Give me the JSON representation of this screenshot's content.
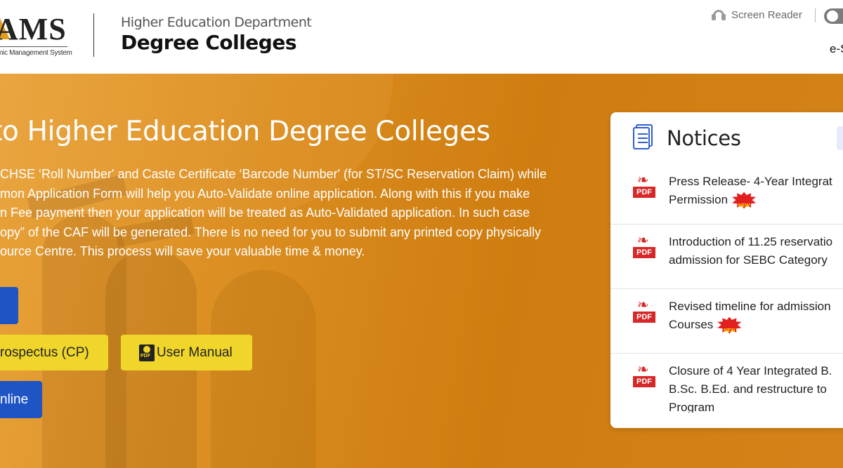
{
  "header": {
    "logo_text": "AMS",
    "logo_subtitle": "mic Management System",
    "department": "Higher Education Department",
    "title": "Degree Colleges",
    "screen_reader_label": "Screen Reader",
    "e_link": "e-S"
  },
  "hero": {
    "title": "to Higher Education Degree Colleges",
    "paragraph": [
      "CHSE ‘Roll Number' and Caste Certificate ‘Barcode Number' (for ST/SC Reservation Claim) while",
      "mon Application Form will help you Auto-Validate online application. Along with this if you make",
      "n Fee payment then your application will be treated as Auto-Validated application. In such case",
      "opy” of the CAF will be generated. There is no need for you to submit any printed copy physically",
      "ource Centre. This process will save your valuable time & money."
    ],
    "buttons": {
      "prospectus": "rospectus (CP)",
      "user_manual": "User Manual",
      "online": "nline"
    }
  },
  "notices": {
    "title": "Notices",
    "items": [
      {
        "lines": [
          "Press Release- 4-Year Integrat",
          "Permission"
        ],
        "is_new": true
      },
      {
        "lines": [
          "Introduction of 11.25 reservatio",
          "admission for SEBC Category"
        ],
        "is_new": false
      },
      {
        "lines": [
          "Revised timeline for admission",
          "Courses"
        ],
        "is_new": true
      },
      {
        "lines": [
          "Closure of 4 Year Integrated B.",
          "B.Sc. B.Ed. and restructure to",
          "Program"
        ],
        "is_new": false
      }
    ],
    "pdf_label": "PDF",
    "new_label": "NEW"
  }
}
